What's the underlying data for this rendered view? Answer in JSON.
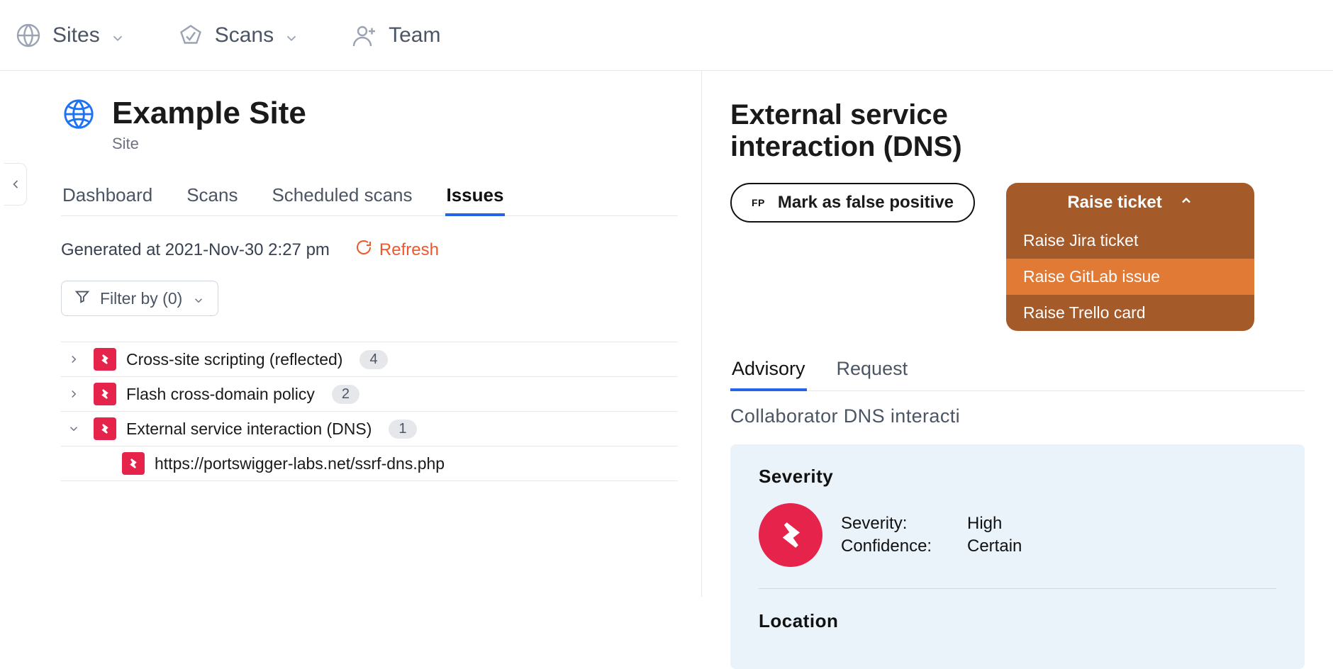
{
  "topnav": {
    "items": [
      {
        "label": "Sites",
        "has_chevron": true,
        "icon": "globe"
      },
      {
        "label": "Scans",
        "has_chevron": true,
        "icon": "scan"
      },
      {
        "label": "Team",
        "has_chevron": false,
        "icon": "team"
      }
    ]
  },
  "site": {
    "name": "Example Site",
    "type_label": "Site"
  },
  "site_tabs": {
    "items": [
      "Dashboard",
      "Scans",
      "Scheduled scans",
      "Issues"
    ],
    "active_index": 3
  },
  "generated": {
    "text": "Generated at 2021-Nov-30 2:27 pm",
    "refresh_label": "Refresh"
  },
  "filter": {
    "label": "Filter by (0)"
  },
  "issues": [
    {
      "expanded": false,
      "name": "Cross-site scripting (reflected)",
      "count": "4"
    },
    {
      "expanded": false,
      "name": "Flash cross-domain policy",
      "count": "2"
    },
    {
      "expanded": true,
      "name": "External service interaction (DNS)",
      "count": "1",
      "children": [
        {
          "name": "https://portswigger-labs.net/ssrf-dns.php"
        }
      ]
    }
  ],
  "detail": {
    "title": "External service interaction (DNS)",
    "fp_badge": "FP",
    "fp_label": "Mark as false positive",
    "raise_button": "Raise ticket",
    "raise_menu": [
      "Raise Jira ticket",
      "Raise GitLab issue",
      "Raise Trello card"
    ],
    "raise_highlight_index": 1,
    "tabs": [
      "Advisory",
      "Request"
    ],
    "tabs_active_index": 0,
    "subheading_truncated": "Collaborator DNS interacti",
    "severity_section_label": "Severity",
    "severity": {
      "label": "Severity:",
      "value": "High"
    },
    "confidence": {
      "label": "Confidence:",
      "value": "Certain"
    },
    "location_section_label": "Location"
  }
}
